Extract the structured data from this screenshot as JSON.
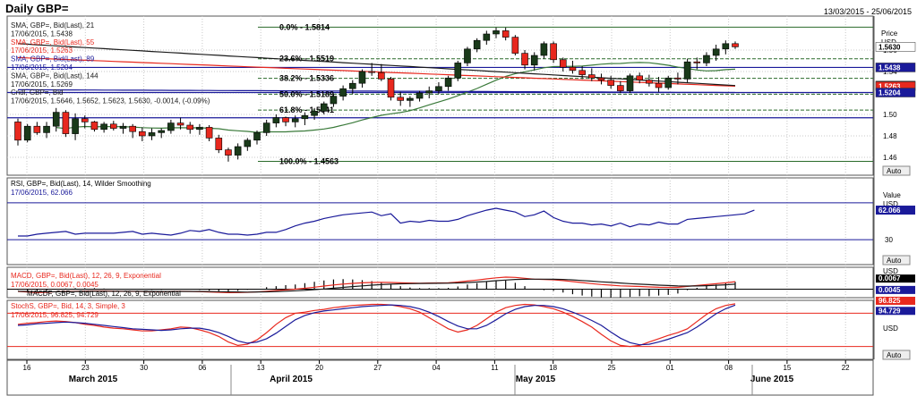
{
  "header": {
    "title": "Daily GBP=",
    "date_range": "13/03/2015 - 25/06/2015"
  },
  "colors": {
    "up": "#1a3a1a",
    "down": "#e8281e",
    "blue": "#1a1a9a",
    "grid": "#c8c8c8"
  },
  "chart_data": [
    {
      "type": "candlestick",
      "title": "Daily GBP=",
      "axis_title": "Price",
      "currency": "USD",
      "auto_label": "Auto",
      "ylim": [
        1.445,
        1.59
      ],
      "yticks": [
        1.46,
        1.48,
        1.5,
        1.52,
        1.54,
        1.56
      ],
      "legend": [
        {
          "lines": [
            "SMA, GBP=, Bid(Last), 21",
            "17/06/2015, 1.5438"
          ],
          "color": "#1a1a1a"
        },
        {
          "lines": [
            "SMA, GBP=, Bid(Last), 55",
            "17/06/2015, 1.5263"
          ],
          "color": "#e8281e"
        },
        {
          "lines": [
            "SMA, GBP=, Bid(Last), 89",
            "17/06/2015, 1.5204"
          ],
          "color": "#1a1a9a"
        },
        {
          "lines": [
            "SMA, GBP=, Bid(Last), 144",
            "17/06/2015, 1.5269"
          ],
          "color": "#1a1a1a"
        },
        {
          "lines": [
            "Cndl, GBP=, Bid",
            "17/06/2015, 1.5646, 1.5652, 1.5623, 1.5630, -0.0014, (-0.09%)"
          ],
          "color": "#1a1a1a"
        }
      ],
      "fib_levels": [
        {
          "label": "0.0%",
          "value": 1.5814,
          "text": "1.5814"
        },
        {
          "label": "23.6%",
          "value": 1.5519,
          "text": "1.5519"
        },
        {
          "label": "38.2%",
          "value": 1.5336,
          "text": "1.5336"
        },
        {
          "label": "50.0%",
          "value": 1.5189,
          "text": "1.5189"
        },
        {
          "label": "61.8%",
          "value": 1.5041,
          "text": "1.5041"
        },
        {
          "label": "100.0%",
          "value": 1.4563,
          "text": "1.4563"
        }
      ],
      "horizontal_lines": [
        1.5438,
        1.5204,
        1.4969
      ],
      "price_tags": [
        {
          "text": "1.5630",
          "value": 1.563,
          "bg": "#ffffff",
          "fg": "#000000"
        },
        {
          "text": "1.5438",
          "value": 1.5438,
          "bg": "#1a1a9a",
          "fg": "#ffffff"
        },
        {
          "text": "1.5269",
          "value": 1.5269,
          "bg": "#000000",
          "fg": "#ffffff"
        },
        {
          "text": "1.5263",
          "value": 1.5263,
          "bg": "#e8281e",
          "fg": "#ffffff"
        },
        {
          "text": "1.5204",
          "value": 1.5204,
          "bg": "#1a1a9a",
          "fg": "#ffffff"
        }
      ],
      "candles": [
        [
          1.493,
          1.496,
          1.471,
          1.476
        ],
        [
          1.476,
          1.491,
          1.474,
          1.489
        ],
        [
          1.489,
          1.493,
          1.481,
          1.483
        ],
        [
          1.483,
          1.493,
          1.478,
          1.489
        ],
        [
          1.489,
          1.506,
          1.484,
          1.502
        ],
        [
          1.502,
          1.504,
          1.479,
          1.482
        ],
        [
          1.482,
          1.501,
          1.476,
          1.496
        ],
        [
          1.496,
          1.499,
          1.487,
          1.493
        ],
        [
          1.493,
          1.494,
          1.484,
          1.486
        ],
        [
          1.486,
          1.493,
          1.483,
          1.491
        ],
        [
          1.491,
          1.494,
          1.485,
          1.487
        ],
        [
          1.487,
          1.492,
          1.482,
          1.489
        ],
        [
          1.489,
          1.491,
          1.478,
          1.484
        ],
        [
          1.484,
          1.488,
          1.475,
          1.48
        ],
        [
          1.48,
          1.487,
          1.476,
          1.483
        ],
        [
          1.483,
          1.487,
          1.478,
          1.485
        ],
        [
          1.485,
          1.495,
          1.482,
          1.492
        ],
        [
          1.492,
          1.497,
          1.486,
          1.49
        ],
        [
          1.49,
          1.493,
          1.482,
          1.486
        ],
        [
          1.486,
          1.491,
          1.481,
          1.488
        ],
        [
          1.488,
          1.49,
          1.475,
          1.478
        ],
        [
          1.478,
          1.481,
          1.464,
          1.467
        ],
        [
          1.467,
          1.469,
          1.456,
          1.462
        ],
        [
          1.462,
          1.473,
          1.458,
          1.47
        ],
        [
          1.47,
          1.478,
          1.466,
          1.476
        ],
        [
          1.476,
          1.485,
          1.472,
          1.483
        ],
        [
          1.483,
          1.495,
          1.48,
          1.492
        ],
        [
          1.492,
          1.5,
          1.488,
          1.497
        ],
        [
          1.497,
          1.498,
          1.489,
          1.493
        ],
        [
          1.493,
          1.499,
          1.488,
          1.496
        ],
        [
          1.496,
          1.502,
          1.49,
          1.499
        ],
        [
          1.499,
          1.506,
          1.495,
          1.503
        ],
        [
          1.503,
          1.512,
          1.5,
          1.51
        ],
        [
          1.51,
          1.519,
          1.507,
          1.517
        ],
        [
          1.517,
          1.527,
          1.513,
          1.524
        ],
        [
          1.524,
          1.532,
          1.519,
          1.529
        ],
        [
          1.529,
          1.542,
          1.525,
          1.54
        ],
        [
          1.54,
          1.548,
          1.536,
          1.539
        ],
        [
          1.539,
          1.547,
          1.531,
          1.533
        ],
        [
          1.533,
          1.535,
          1.513,
          1.516
        ],
        [
          1.516,
          1.521,
          1.508,
          1.513
        ],
        [
          1.513,
          1.517,
          1.507,
          1.515
        ],
        [
          1.515,
          1.522,
          1.512,
          1.52
        ],
        [
          1.52,
          1.526,
          1.515,
          1.522
        ],
        [
          1.522,
          1.53,
          1.519,
          1.526
        ],
        [
          1.526,
          1.536,
          1.522,
          1.534
        ],
        [
          1.534,
          1.55,
          1.531,
          1.548
        ],
        [
          1.548,
          1.563,
          1.545,
          1.561
        ],
        [
          1.561,
          1.571,
          1.558,
          1.569
        ],
        [
          1.569,
          1.578,
          1.565,
          1.575
        ],
        [
          1.575,
          1.581,
          1.571,
          1.578
        ],
        [
          1.578,
          1.581,
          1.569,
          1.572
        ],
        [
          1.572,
          1.574,
          1.555,
          1.557
        ],
        [
          1.557,
          1.56,
          1.542,
          1.546
        ],
        [
          1.546,
          1.558,
          1.541,
          1.555
        ],
        [
          1.555,
          1.568,
          1.552,
          1.566
        ],
        [
          1.566,
          1.568,
          1.548,
          1.551
        ],
        [
          1.551,
          1.553,
          1.54,
          1.544
        ],
        [
          1.544,
          1.55,
          1.538,
          1.541
        ],
        [
          1.541,
          1.545,
          1.533,
          1.537
        ],
        [
          1.537,
          1.543,
          1.531,
          1.534
        ],
        [
          1.534,
          1.538,
          1.528,
          1.532
        ],
        [
          1.532,
          1.536,
          1.524,
          1.527
        ],
        [
          1.527,
          1.531,
          1.52,
          1.522
        ],
        [
          1.522,
          1.538,
          1.52,
          1.536
        ],
        [
          1.536,
          1.539,
          1.529,
          1.532
        ],
        [
          1.532,
          1.537,
          1.526,
          1.529
        ],
        [
          1.529,
          1.535,
          1.521,
          1.525
        ],
        [
          1.525,
          1.536,
          1.523,
          1.534
        ],
        [
          1.534,
          1.539,
          1.528,
          1.533
        ],
        [
          1.533,
          1.552,
          1.53,
          1.549
        ],
        [
          1.549,
          1.553,
          1.542,
          1.548
        ],
        [
          1.548,
          1.558,
          1.545,
          1.555
        ],
        [
          1.555,
          1.565,
          1.55,
          1.561
        ],
        [
          1.561,
          1.569,
          1.556,
          1.566
        ],
        [
          1.566,
          1.568,
          1.561,
          1.563
        ]
      ]
    },
    {
      "type": "line",
      "title": "RSI, GBP=, Bid(Last), 14, Wilder Smoothing",
      "value_line": "17/06/2015, 62.066",
      "axis_title": "Value",
      "unit": "USD",
      "auto_label": "Auto",
      "ylim": [
        5,
        95
      ],
      "yticks": [
        30
      ],
      "hlines": [
        70,
        30
      ],
      "value_tag": "62.066",
      "series": [
        {
          "values": [
            34,
            34,
            36,
            37,
            38,
            39,
            36,
            37,
            37,
            37,
            37,
            38,
            39,
            36,
            37,
            36,
            35,
            37,
            40,
            39,
            41,
            38,
            36,
            36,
            35,
            36,
            38,
            38,
            41,
            45,
            48,
            50,
            53,
            55,
            57,
            58,
            59,
            60,
            56,
            58,
            48,
            50,
            49,
            51,
            50,
            50,
            52,
            56,
            59,
            62,
            64,
            62,
            60,
            55,
            57,
            61,
            54,
            50,
            48,
            48,
            46,
            47,
            45,
            48,
            44,
            47,
            46,
            49,
            47,
            47,
            52,
            53,
            54,
            55,
            56,
            57,
            58,
            62
          ]
        }
      ]
    },
    {
      "type": "line",
      "title": "MACD, GBP=, Bid(Last), 12, 26, 9, Exponential",
      "value_line": "17/06/2015, 0.0067, 0.0045",
      "histogram_title": "MACDF, GBP=, Bid(Last), 12, 26, 9, Exponential",
      "unit": "USD",
      "auto_label": "Auto",
      "ylim": [
        -0.006,
        0.018
      ],
      "value_tags": [
        "0.0067",
        "0.0045"
      ],
      "series": [
        {
          "values": [
            -0.002,
            -0.0025,
            -0.003,
            -0.0028,
            -0.0022,
            -0.002,
            -0.0018,
            -0.0017,
            -0.0016,
            -0.0016,
            -0.0017,
            -0.0018,
            -0.0019,
            -0.002,
            -0.0021,
            -0.0022,
            -0.002,
            -0.0019,
            -0.002,
            -0.0022,
            -0.0025,
            -0.0028,
            -0.0031,
            -0.003,
            -0.0028,
            -0.0024,
            -0.0018,
            -0.0012,
            -0.0006,
            0.0,
            0.0008,
            0.0018,
            0.0028,
            0.0038,
            0.0046,
            0.0052,
            0.0057,
            0.006,
            0.0061,
            0.006,
            0.0057,
            0.0055,
            0.0054,
            0.0055,
            0.0056,
            0.0058,
            0.0064,
            0.0073,
            0.0082,
            0.0092,
            0.0102,
            0.0108,
            0.0106,
            0.0098,
            0.009,
            0.0087,
            0.0084,
            0.0077,
            0.0068,
            0.0059,
            0.005,
            0.0042,
            0.0036,
            0.003,
            0.0027,
            0.0024,
            0.002,
            0.0017,
            0.0016,
            0.0016,
            0.0025,
            0.0033,
            0.0041,
            0.0049,
            0.0057,
            0.0067
          ]
        },
        {
          "values": [
            -0.0018,
            -0.002,
            -0.0022,
            -0.0023,
            -0.0023,
            -0.0022,
            -0.0021,
            -0.002,
            -0.0019,
            -0.0018,
            -0.0018,
            -0.0018,
            -0.0018,
            -0.0019,
            -0.0019,
            -0.002,
            -0.002,
            -0.002,
            -0.002,
            -0.002,
            -0.0021,
            -0.0022,
            -0.0024,
            -0.0025,
            -0.0026,
            -0.0025,
            -0.0024,
            -0.0021,
            -0.0018,
            -0.0014,
            -0.001,
            -0.0004,
            0.0002,
            0.0009,
            0.0016,
            0.0023,
            0.003,
            0.0036,
            0.0041,
            0.0045,
            0.0048,
            0.005,
            0.0051,
            0.0052,
            0.0053,
            0.0054,
            0.0056,
            0.0059,
            0.0064,
            0.0069,
            0.0076,
            0.0082,
            0.0087,
            0.0089,
            0.009,
            0.009,
            0.0089,
            0.0087,
            0.0083,
            0.0078,
            0.0072,
            0.0066,
            0.0061,
            0.0055,
            0.005,
            0.0045,
            0.0041,
            0.0036,
            0.0033,
            0.0029,
            0.0028,
            0.0029,
            0.0031,
            0.0035,
            0.0039,
            0.0045
          ]
        }
      ]
    },
    {
      "type": "line",
      "title": "StochS, GBP=, Bid, 14, 3, Simple, 3",
      "value_line": "17/06/2015, 96.825, 94.729",
      "unit": "USD",
      "auto_label": "Auto",
      "ylim": [
        0,
        100
      ],
      "hlines": [
        80,
        20
      ],
      "value_tags": [
        "96.825",
        "94.729"
      ],
      "series": [
        {
          "values": [
            60,
            62,
            63,
            65,
            66,
            65,
            63,
            60,
            58,
            55,
            53,
            52,
            50,
            48,
            48,
            50,
            52,
            55,
            54,
            50,
            45,
            38,
            28,
            22,
            24,
            32,
            45,
            60,
            72,
            80,
            82,
            85,
            87,
            90,
            92,
            94,
            95,
            96,
            96,
            95,
            92,
            88,
            82,
            72,
            62,
            52,
            46,
            50,
            58,
            70,
            82,
            90,
            94,
            96,
            95,
            92,
            88,
            82,
            74,
            65,
            55,
            42,
            30,
            22,
            20,
            22,
            28,
            34,
            40,
            45,
            52,
            65,
            78,
            88,
            94,
            97
          ]
        },
        {
          "values": [
            58,
            59,
            61,
            62,
            63,
            64,
            63,
            62,
            60,
            58,
            56,
            54,
            52,
            51,
            50,
            49,
            50,
            52,
            53,
            53,
            50,
            45,
            38,
            30,
            26,
            28,
            34,
            44,
            56,
            68,
            76,
            81,
            84,
            86,
            88,
            90,
            92,
            93,
            94,
            95,
            94,
            92,
            88,
            82,
            74,
            65,
            57,
            52,
            52,
            58,
            68,
            79,
            87,
            92,
            94,
            94,
            92,
            88,
            82,
            75,
            67,
            58,
            46,
            35,
            27,
            23,
            24,
            28,
            33,
            39,
            45,
            55,
            67,
            79,
            88,
            94.7
          ]
        }
      ]
    }
  ],
  "x_axis": {
    "day_ticks": [
      "16",
      "23",
      "30",
      "06",
      "13",
      "20",
      "27",
      "04",
      "11",
      "18",
      "25",
      "01",
      "08",
      "15",
      "22"
    ],
    "month_labels": [
      "March 2015",
      "April 2015",
      "May 2015",
      "June 2015"
    ]
  }
}
